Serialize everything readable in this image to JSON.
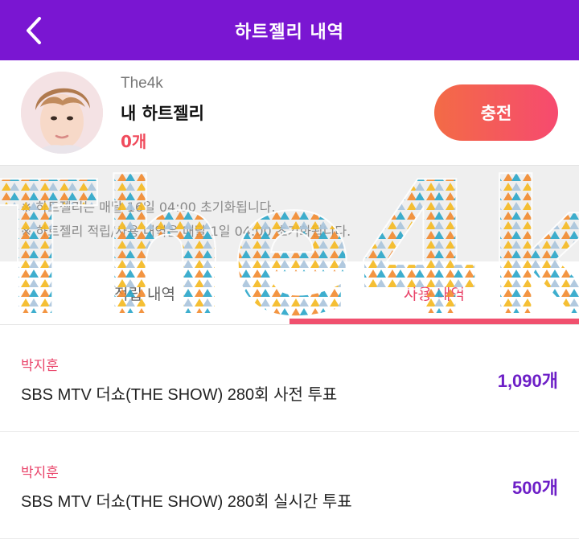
{
  "header": {
    "title": "하트젤리 내역",
    "back_icon": "chevron-left-icon"
  },
  "profile": {
    "username": "The4k",
    "my_label": "내 하트젤리",
    "count": "0개",
    "charge_label": "충전"
  },
  "notice": {
    "line1": "※ 하트젤리는 매달 16일 04:00 초기화됩니다.",
    "line2": "※ 하트젤리 적립/사용 내역은 매달 1일 04:00 초기화됩니다."
  },
  "tabs": [
    {
      "label": "적립 내역"
    },
    {
      "label": "사용 내역"
    }
  ],
  "active_tab": "사용 내역",
  "history": [
    {
      "artist": "박지훈",
      "desc": "SBS MTV 더쇼(THE SHOW) 280회 사전 투표",
      "amount": "1,090개"
    },
    {
      "artist": "박지훈",
      "desc": "SBS MTV 더쇼(THE SHOW) 280회 실시간 투표",
      "amount": "500개"
    }
  ],
  "watermark_text": "The4k",
  "colors": {
    "header_bg": "#7a16d2",
    "accent_pink": "#e9446a",
    "amount_purple": "#6d1fc7",
    "charge_gradient_start": "#f36b46",
    "charge_gradient_end": "#f64a6f"
  }
}
